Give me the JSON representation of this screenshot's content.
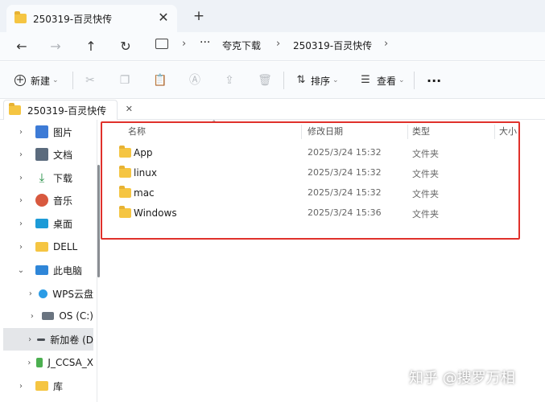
{
  "tab": {
    "title": "250319-百灵快传",
    "close_glyph": "✕",
    "new_glyph": "+"
  },
  "nav": {
    "back": "←",
    "forward": "→",
    "up": "↑",
    "refresh": "↻"
  },
  "breadcrumb": {
    "more": "···",
    "items": [
      "夸克下载",
      "250319-百灵快传"
    ],
    "sep": "›"
  },
  "toolbar": {
    "new_label": "新建",
    "sort_label": "排序",
    "view_label": "查看",
    "more": "···"
  },
  "location_tab": {
    "title": "250319-百灵快传",
    "close_glyph": "✕"
  },
  "sidebar": {
    "items": [
      {
        "label": "图片",
        "chev": "›"
      },
      {
        "label": "文档",
        "chev": "›"
      },
      {
        "label": "下载",
        "chev": "›"
      },
      {
        "label": "音乐",
        "chev": "›"
      },
      {
        "label": "桌面",
        "chev": "›"
      },
      {
        "label": "DELL",
        "chev": "›"
      },
      {
        "label": "此电脑",
        "chev": "⌄"
      },
      {
        "label": "WPS云盘",
        "chev": "›"
      },
      {
        "label": "OS (C:)",
        "chev": "›"
      },
      {
        "label": "新加卷 (D",
        "chev": "›"
      },
      {
        "label": "J_CCSA_X",
        "chev": "›"
      },
      {
        "label": "库",
        "chev": "›"
      }
    ]
  },
  "columns": {
    "name": "名称",
    "date": "修改日期",
    "type": "类型",
    "size": "大小"
  },
  "files": [
    {
      "name": "App",
      "date": "2025/3/24 15:32",
      "type": "文件夹"
    },
    {
      "name": "linux",
      "date": "2025/3/24 15:32",
      "type": "文件夹"
    },
    {
      "name": "mac",
      "date": "2025/3/24 15:32",
      "type": "文件夹"
    },
    {
      "name": "Windows",
      "date": "2025/3/24 15:36",
      "type": "文件夹"
    }
  ],
  "watermark": "知乎 @搜罗万相",
  "colors": {
    "highlight_box": "#e0312b",
    "folder": "#f5c542",
    "accent": "#0067c0"
  }
}
